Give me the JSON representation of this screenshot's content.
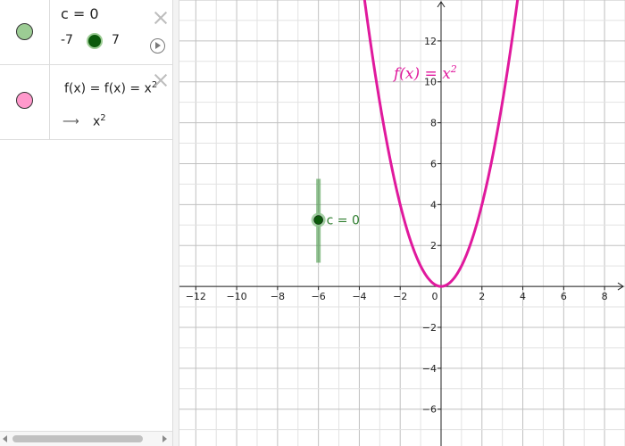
{
  "algebra": {
    "slider_row": {
      "definition": "c = 0",
      "min": "-7",
      "max": "7",
      "marble_color": "#9ccc94",
      "icons": [
        "delete-icon",
        "play-icon"
      ]
    },
    "function_row": {
      "definition": "f(x) = f(x) = x",
      "definition_exponent": "2",
      "output_arrow": "⟶",
      "output": "x",
      "output_exponent": "2",
      "marble_color": "#ff99cc",
      "icons": [
        "delete-icon"
      ]
    }
  },
  "graphics": {
    "x_ticks": [
      "−12",
      "−10",
      "−8",
      "−6",
      "−4",
      "−2",
      "0",
      "2",
      "4",
      "6",
      "8"
    ],
    "y_ticks": [
      "12",
      "10",
      "8",
      "6",
      "4",
      "2",
      "−2",
      "−4",
      "−6"
    ],
    "function_label": "f(x) =  x",
    "function_label_exponent": "2",
    "slider_label": "c = 0",
    "curve_color": "#e0199d",
    "slider_color": "#2e7d2e"
  },
  "chart_data": {
    "type": "line",
    "series": [
      {
        "name": "f(x) =  x²",
        "x": [
          -3.7,
          -3,
          -2.5,
          -2,
          -1.5,
          -1,
          -0.5,
          0,
          0.5,
          1,
          1.5,
          2,
          2.5,
          3,
          3.7
        ],
        "y": [
          13.69,
          9,
          6.25,
          4,
          2.25,
          1,
          0.25,
          0,
          0.25,
          1,
          2.25,
          4,
          6.25,
          9,
          13.69
        ]
      }
    ],
    "slider_point": {
      "x": -6,
      "y": 3.25,
      "value": 0,
      "min": -7,
      "max": 7
    },
    "xlim": [
      -12.8,
      9
    ],
    "ylim": [
      -7.8,
      14
    ],
    "grid": true,
    "x_tick_values": [
      -12,
      -10,
      -8,
      -6,
      -4,
      -2,
      0,
      2,
      4,
      6,
      8
    ],
    "y_tick_values": [
      12,
      10,
      8,
      6,
      4,
      2,
      -2,
      -4,
      -6
    ]
  }
}
